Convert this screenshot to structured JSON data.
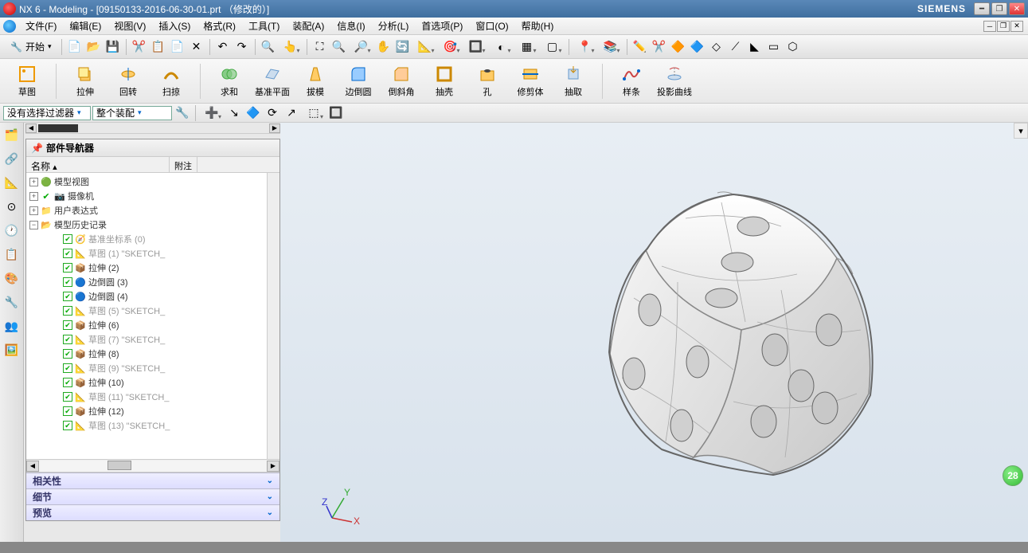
{
  "title": "NX 6 - Modeling - [09150133-2016-06-30-01.prt （修改的）]",
  "brand": "SIEMENS",
  "menu": {
    "file": "文件(F)",
    "edit": "编辑(E)",
    "view": "视图(V)",
    "insert": "插入(S)",
    "format": "格式(R)",
    "tools": "工具(T)",
    "assemblies": "装配(A)",
    "information": "信息(I)",
    "analysis": "分析(L)",
    "preferences": "首选项(P)",
    "window": "窗口(O)",
    "help": "帮助(H)"
  },
  "start": {
    "label": "开始",
    "drop": "▾"
  },
  "ribbon": {
    "sketch": "草图",
    "extrude": "拉伸",
    "revolve": "回转",
    "sweep": "扫掠",
    "unite": "求和",
    "datum_plane": "基准平面",
    "draft": "拔模",
    "edge_blend": "边倒圆",
    "chamfer": "倒斜角",
    "shell": "抽壳",
    "hole": "孔",
    "trim_body": "修剪体",
    "extract": "抽取",
    "spline": "样条",
    "project_curve": "投影曲线"
  },
  "filter": {
    "selection": "没有选择过滤器",
    "assembly": "整个装配"
  },
  "nav": {
    "title": "部件导航器",
    "col_name": "名称",
    "col_note": "附注",
    "tree": {
      "model_views": "模型视图",
      "cameras": "摄像机",
      "user_expr": "用户表达式",
      "history": "模型历史记录",
      "items": [
        {
          "label": "基准坐标系 (0)",
          "icon": "csys",
          "gray": true
        },
        {
          "label": "草图 (1) \"SKETCH_",
          "icon": "sketch",
          "gray": true
        },
        {
          "label": "拉伸 (2)",
          "icon": "extrude"
        },
        {
          "label": "边倒圆 (3)",
          "icon": "blend"
        },
        {
          "label": "边倒圆 (4)",
          "icon": "blend"
        },
        {
          "label": "草图 (5) \"SKETCH_",
          "icon": "sketch",
          "gray": true
        },
        {
          "label": "拉伸 (6)",
          "icon": "extrude"
        },
        {
          "label": "草图 (7) \"SKETCH_",
          "icon": "sketch",
          "gray": true
        },
        {
          "label": "拉伸 (8)",
          "icon": "extrude"
        },
        {
          "label": "草图 (9) \"SKETCH_",
          "icon": "sketch",
          "gray": true
        },
        {
          "label": "拉伸 (10)",
          "icon": "extrude"
        },
        {
          "label": "草图 (11) \"SKETCH_",
          "icon": "sketch",
          "gray": true
        },
        {
          "label": "拉伸 (12)",
          "icon": "extrude"
        },
        {
          "label": "草图 (13) \"SKETCH_",
          "icon": "sketch",
          "gray": true
        }
      ]
    },
    "sections": {
      "dependency": "相关性",
      "details": "细节",
      "preview": "预览"
    }
  },
  "badge": "28",
  "triad": {
    "x": "X",
    "y": "Y",
    "z": "Z"
  }
}
